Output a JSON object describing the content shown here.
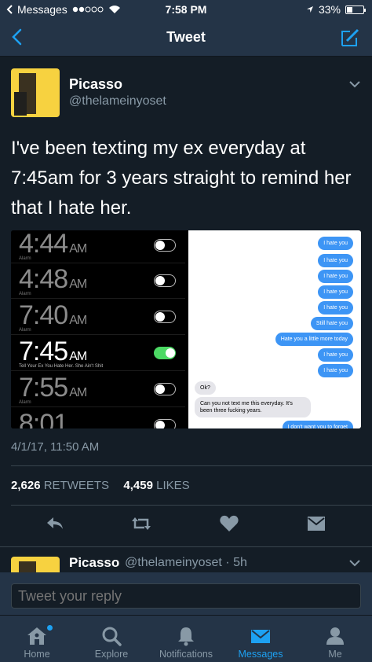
{
  "status_bar": {
    "carrier": "Messages",
    "time": "7:58 PM",
    "battery": "33%",
    "battery_level": 0.33
  },
  "nav": {
    "title": "Tweet",
    "back_icon": "chevron-left-icon",
    "compose_icon": "compose-icon"
  },
  "tweet": {
    "author_name": "Picasso",
    "author_handle": "@thelameinyoset",
    "text": "I've been texting my ex everyday at 7:45am for 3 years straight to remind her that I hate her.",
    "timestamp": "4/1/17, 11:50 AM",
    "retweets": "2,626",
    "retweets_label": "RETWEETS",
    "likes": "4,459",
    "likes_label": "LIKES"
  },
  "media": {
    "alarms": [
      {
        "time": "4:44",
        "ampm": "AM",
        "label": "Alarm",
        "on": false
      },
      {
        "time": "4:48",
        "ampm": "AM",
        "label": "Alarm",
        "on": false
      },
      {
        "time": "7:40",
        "ampm": "AM",
        "label": "Alarm",
        "on": false
      },
      {
        "time": "7:45",
        "ampm": "AM",
        "label": "Tell Your Ex You Hate Her. She Ain't Shit",
        "on": true
      },
      {
        "time": "7:55",
        "ampm": "AM",
        "label": "Alarm",
        "on": false
      },
      {
        "time": "8:01",
        "ampm": "",
        "label": "",
        "on": false
      }
    ],
    "messages": [
      {
        "from": "me",
        "text": "I hate you"
      },
      {
        "from": "me",
        "text": "I hate you"
      },
      {
        "from": "me",
        "text": "I hate you"
      },
      {
        "from": "me",
        "text": "I hate you"
      },
      {
        "from": "me",
        "text": "I hate you"
      },
      {
        "from": "me",
        "text": "Still hate you"
      },
      {
        "from": "me",
        "text": "Hate you a little more today"
      },
      {
        "from": "me",
        "text": "I hate you"
      },
      {
        "from": "me",
        "text": "I hate you"
      },
      {
        "from": "them",
        "text": "Ok?"
      },
      {
        "from": "them",
        "text": "Can you not text me this everyday. It's been three fucking years."
      },
      {
        "from": "me",
        "text": "I don't want you to forget"
      }
    ]
  },
  "reply_preview": {
    "name": "Picasso",
    "handle": "@thelameinyoset · 5h"
  },
  "reply_bar": {
    "placeholder": "Tweet your reply"
  },
  "tabs": [
    {
      "label": "Home",
      "icon": "home-icon",
      "active": false
    },
    {
      "label": "Explore",
      "icon": "search-icon",
      "active": false
    },
    {
      "label": "Notifications",
      "icon": "bell-icon",
      "active": false
    },
    {
      "label": "Messages",
      "icon": "envelope-icon",
      "active": true
    },
    {
      "label": "Me",
      "icon": "person-icon",
      "active": false
    }
  ],
  "colors": {
    "background": "#141d26",
    "bar": "#243447",
    "accent": "#1da1f2",
    "muted": "#8899a6"
  }
}
